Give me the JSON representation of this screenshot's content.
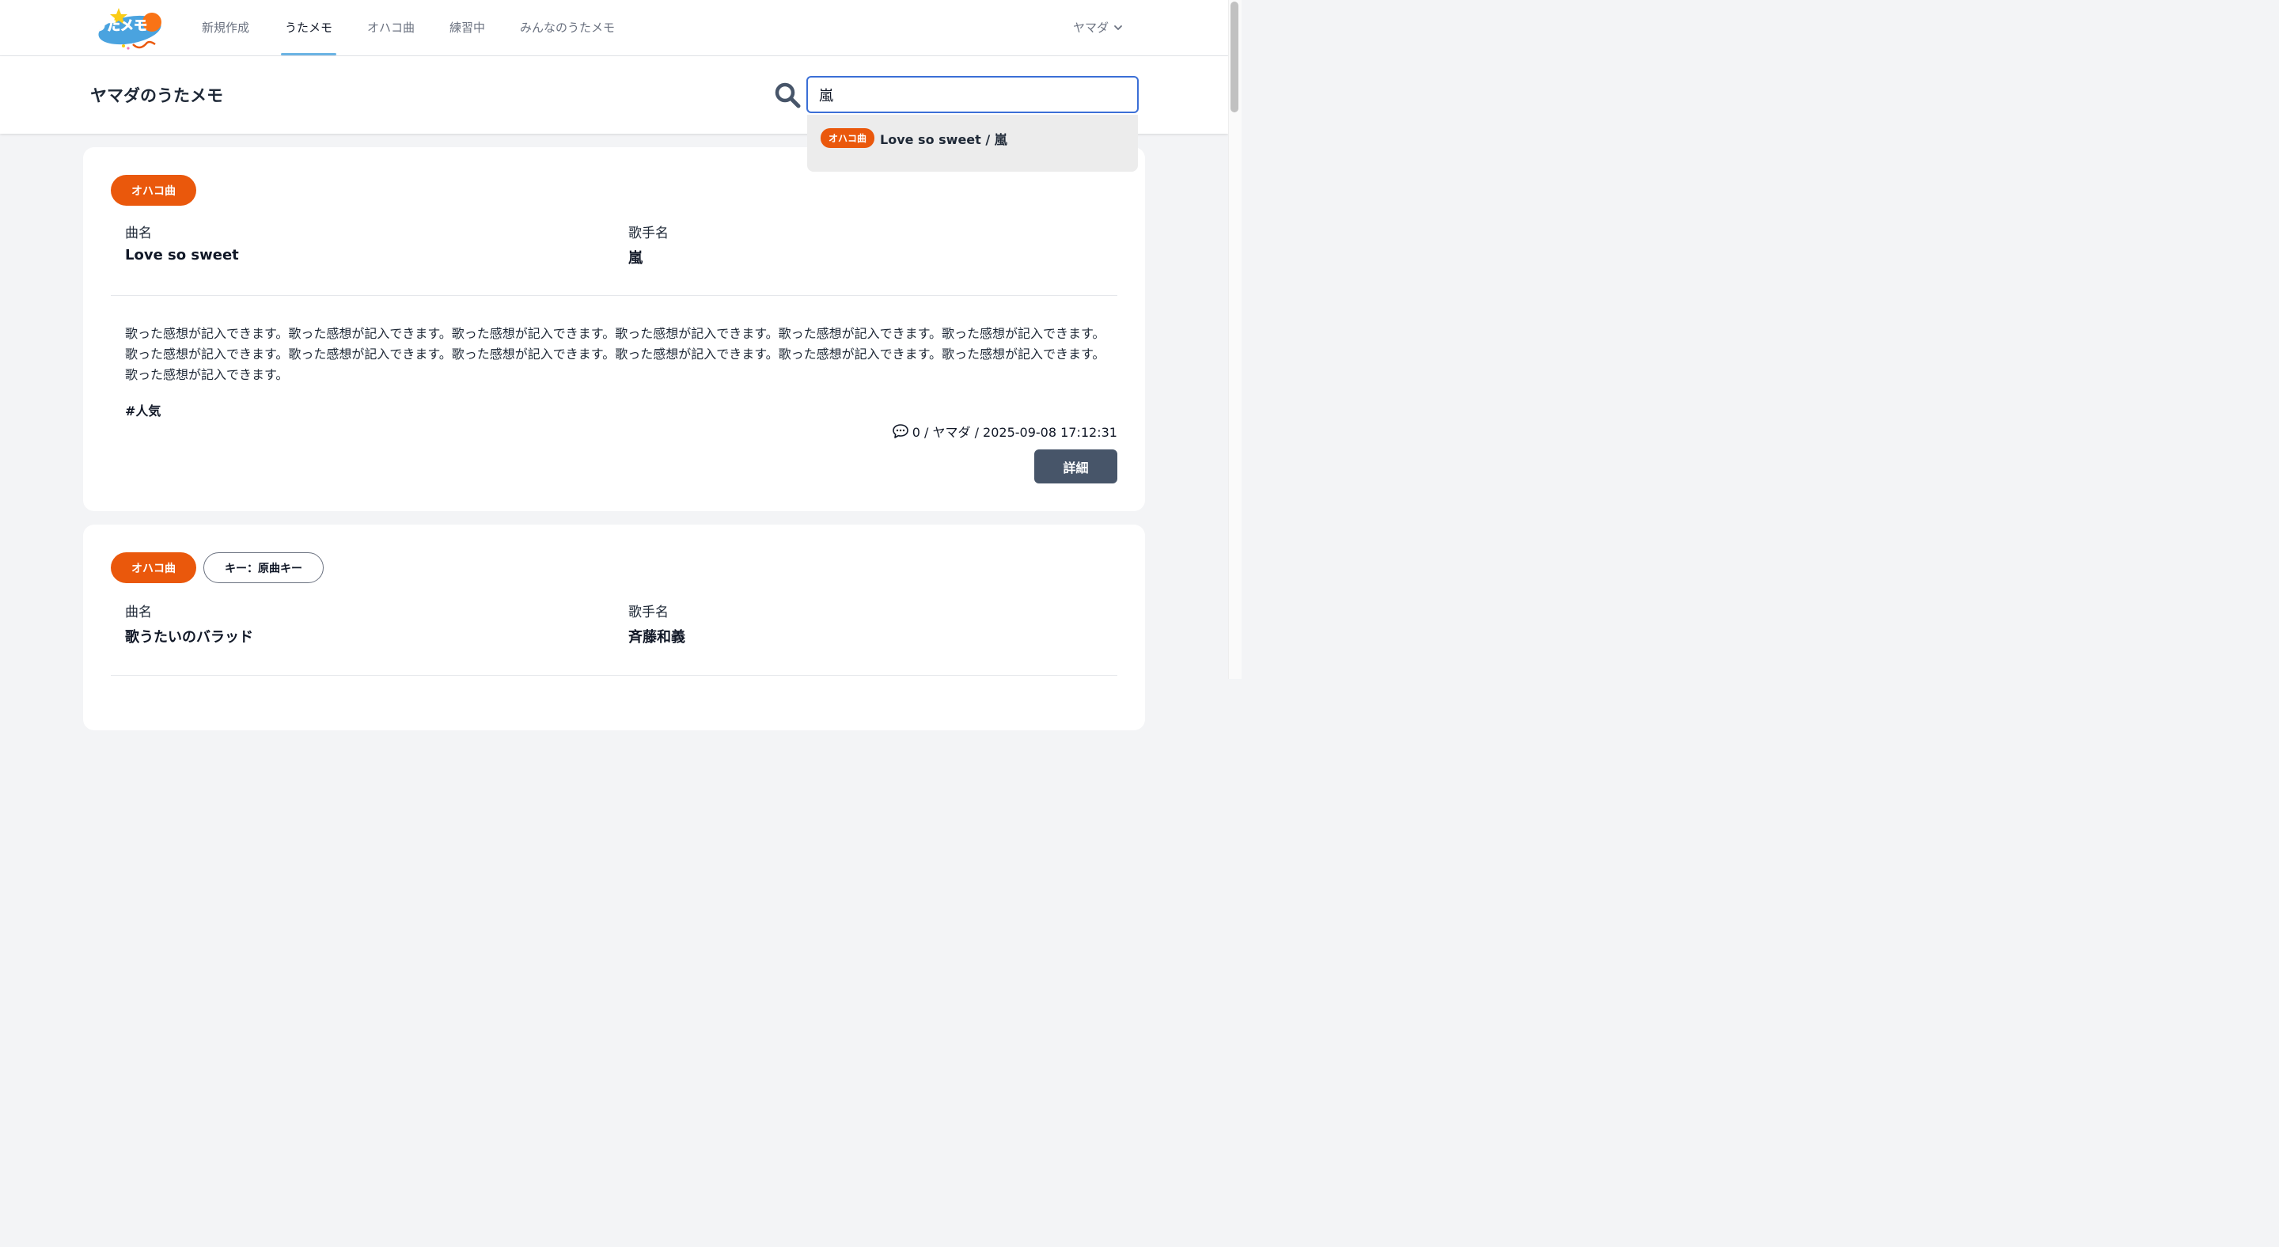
{
  "nav": {
    "logo_text": "うたメモ",
    "items": [
      {
        "label": "新規作成",
        "active": false
      },
      {
        "label": "うたメモ",
        "active": true
      },
      {
        "label": "オハコ曲",
        "active": false
      },
      {
        "label": "練習中",
        "active": false
      },
      {
        "label": "みんなのうたメモ",
        "active": false
      }
    ],
    "user": "ヤマダ",
    "user_icon": "chevron-down-icon"
  },
  "header": {
    "title": "ヤマダのうたメモ",
    "search_value": "嵐",
    "search_icon": "search-icon"
  },
  "suggestions": [
    {
      "tag": "オハコ曲",
      "text": "Love so sweet / 嵐"
    }
  ],
  "field_labels": {
    "song": "曲名",
    "artist": "歌手名"
  },
  "cards": [
    {
      "tags": [
        "オハコ曲"
      ],
      "song": "Love so sweet",
      "artist": "嵐",
      "memo": "歌った感想が記入できます。歌った感想が記入できます。歌った感想が記入できます。歌った感想が記入できます。歌った感想が記入できます。歌った感想が記入できます。歌った感想が記入できます。歌った感想が記入できます。歌った感想が記入できます。歌った感想が記入できます。歌った感想が記入できます。歌った感想が記入できます。歌った感想が記入できます。",
      "hashtag": "#人気",
      "meta": "0 / ヤマダ / 2025-09-08 17:12:31",
      "detail_label": "詳細"
    },
    {
      "tags": [
        "オハコ曲",
        "キー：原曲キー"
      ],
      "song": "歌うたいのバラッド",
      "artist": "斉藤和義"
    }
  ],
  "colors": {
    "accent": "#ea580c",
    "nav_underline": "#6cb4e4",
    "button": "#475569",
    "focus": "#3b6fd6"
  }
}
